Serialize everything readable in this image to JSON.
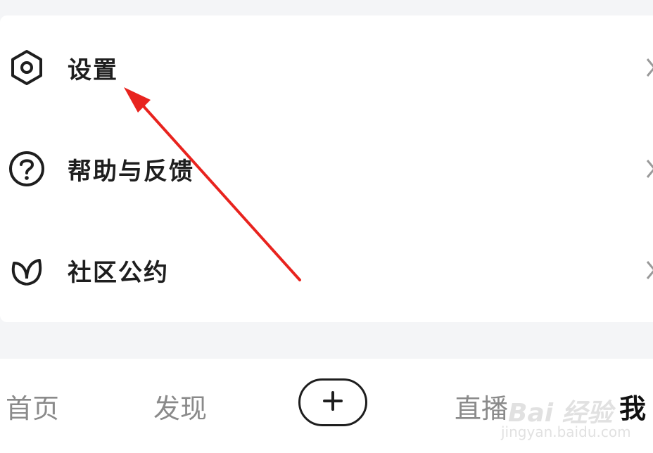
{
  "menu": {
    "items": [
      {
        "label": "设置",
        "icon": "settings-hex-icon"
      },
      {
        "label": "帮助与反馈",
        "icon": "help-question-icon"
      },
      {
        "label": "社区公约",
        "icon": "community-leaf-icon"
      }
    ]
  },
  "tabbar": {
    "home": "首页",
    "discover": "发现",
    "add": "plus-icon",
    "live": "直播",
    "me": "我"
  },
  "watermark": {
    "brand": "Bai 经验",
    "url": "jingyan.baidu.com"
  },
  "colors": {
    "annotation_arrow": "#e8231e",
    "active_tab": "#111111",
    "inactive_tab": "#8a8a8a",
    "background": "#f4f5f7"
  }
}
